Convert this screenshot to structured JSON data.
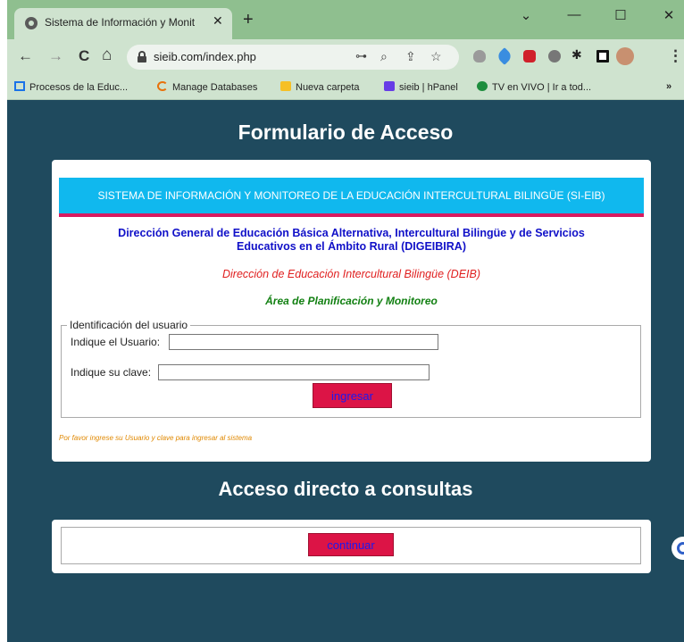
{
  "browser": {
    "tab_title": "Sistema de Información y Monit",
    "tab_close": "✕",
    "new_tab": "+",
    "window_controls": [
      "⌄",
      "—",
      "☐",
      "✕"
    ],
    "url": "sieib.com/index.php",
    "nav": {
      "back": "←",
      "forward": "→",
      "reload": "C",
      "home": "⌂"
    },
    "bookmarks": [
      {
        "label": "Procesos de la Educ...",
        "icon": "grid-icon",
        "color": "#1a73e8"
      },
      {
        "label": "Manage Databases",
        "icon": "db-icon",
        "color": "#e8710a"
      },
      {
        "label": "Nueva carpeta",
        "icon": "folder-icon",
        "color": "#f6c026"
      },
      {
        "label": "sieib | hPanel",
        "icon": "hpanel-icon",
        "color": "#673de6"
      },
      {
        "label": "TV en VIVO | Ir a tod...",
        "icon": "play-icon",
        "color": "#1e8e3e"
      }
    ],
    "bookmarks_more": "»"
  },
  "login": {
    "title": "Formulario de Acceso",
    "banner": "SISTEMA DE INFORMACIÓN Y MONITOREO DE LA EDUCACIÓN INTERCULTURAL BILINGÜE (SI-EIB)",
    "direccion_general_1": "Dirección General de Educación Básica Alternativa, Intercultural Bilingüe y de Servicios",
    "direccion_general_2": "Educativos en el Ámbito Rural (DIGEIBIRA)",
    "direccion_deib": "Dirección de Educación Intercultural Bilingüe (DEIB)",
    "area": "Área de Planificación y Monitoreo",
    "fieldset_legend": "Identificación del usuario",
    "user_label": "Indique el Usuario:",
    "user_value": "",
    "pass_label": "Indique su clave:",
    "pass_value": "",
    "submit_label": "ingresar",
    "hint": "Por favor ingrese su Usuario y clave para ingresar al sistema"
  },
  "consultas": {
    "title": "Acceso directo a consultas",
    "button_label": "continuar"
  },
  "colors": {
    "page_bg": "#1f4a5e",
    "banner": "#10b8ee",
    "accent_red": "#dc1446",
    "blue_text": "#1010c8",
    "red_text": "#e02020",
    "green_text": "#128012",
    "hint_text": "#e08800"
  }
}
